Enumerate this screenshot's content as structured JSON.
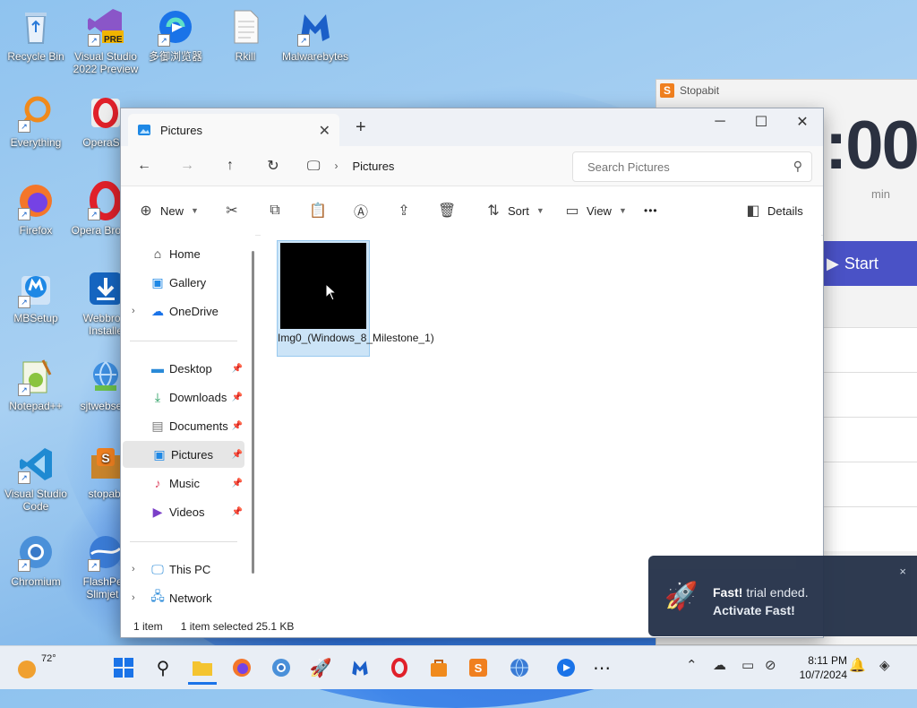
{
  "desktop": {
    "icons": [
      {
        "label": "Recycle Bin"
      },
      {
        "label": "Visual Studio 2022 Preview",
        "badge": "PRE"
      },
      {
        "label": "多御浏览器"
      },
      {
        "label": "Rkill"
      },
      {
        "label": "Malwarebytes"
      },
      {
        "label": "Everything"
      },
      {
        "label": "OperaSet"
      },
      {
        "label": "Firefox"
      },
      {
        "label": "Opera Browse"
      },
      {
        "label": "MBSetup"
      },
      {
        "label": "Webbrow Installe"
      },
      {
        "label": "Notepad++"
      },
      {
        "label": "sjtwebsetu"
      },
      {
        "label": "Visual Studio Code"
      },
      {
        "label": "stopabi"
      },
      {
        "label": "Chromium"
      },
      {
        "label": "FlashPea Slimjet ("
      }
    ]
  },
  "stopabit": {
    "title": "Stopabit",
    "logo_letter": "S",
    "time": ":00",
    "unit": "min",
    "start_label": "Start"
  },
  "explorer": {
    "tab_title": "Pictures",
    "new_tab": "+",
    "address": {
      "path": "Pictures"
    },
    "search": {
      "placeholder": "Search Pictures"
    },
    "commands": {
      "new": "New",
      "sort": "Sort",
      "view": "View",
      "more": "•••",
      "details": "Details"
    },
    "nav": {
      "home": "Home",
      "gallery": "Gallery",
      "onedrive": "OneDrive",
      "desktop": "Desktop",
      "downloads": "Downloads",
      "documents": "Documents",
      "pictures": "Pictures",
      "music": "Music",
      "videos": "Videos",
      "thispc": "This PC",
      "network": "Network"
    },
    "files": [
      {
        "name": "Img0_(Windows_8_Milestone_1)"
      }
    ],
    "status": {
      "count": "1 item",
      "selection": "1 item selected  25.1 KB"
    }
  },
  "toast": {
    "line1_bold": "Fast!",
    "line1_rest": " trial ended.",
    "line2": "Activate Fast!",
    "close": "×"
  },
  "taskbar": {
    "temperature": "72°",
    "time": "8:11 PM",
    "date": "10/7/2024"
  },
  "colors": {
    "accent": "#0067c0",
    "selection_bg": "#cce4f7",
    "stopabit_button": "#4a52c6",
    "toast_bg": "#26334a"
  }
}
